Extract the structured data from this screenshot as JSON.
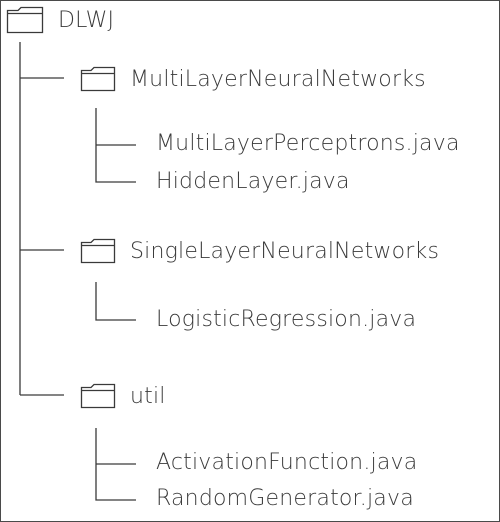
{
  "tree": {
    "root": {
      "label": "DLWJ",
      "icon": "folder-icon"
    },
    "folders": [
      {
        "label": "MultiLayerNeuralNetworks",
        "icon": "folder-icon",
        "files": [
          "MultiLayerPerceptrons.java",
          "HiddenLayer.java"
        ]
      },
      {
        "label": "SingleLayerNeuralNetworks",
        "icon": "folder-icon",
        "files": [
          "LogisticRegression.java"
        ]
      },
      {
        "label": "util",
        "icon": "folder-icon",
        "files": [
          "ActivationFunction.java",
          "RandomGenerator.java"
        ]
      }
    ]
  },
  "colors": {
    "line": "#3a3a3a",
    "text": "#3a3a3a",
    "border": "#4a4a4a"
  }
}
